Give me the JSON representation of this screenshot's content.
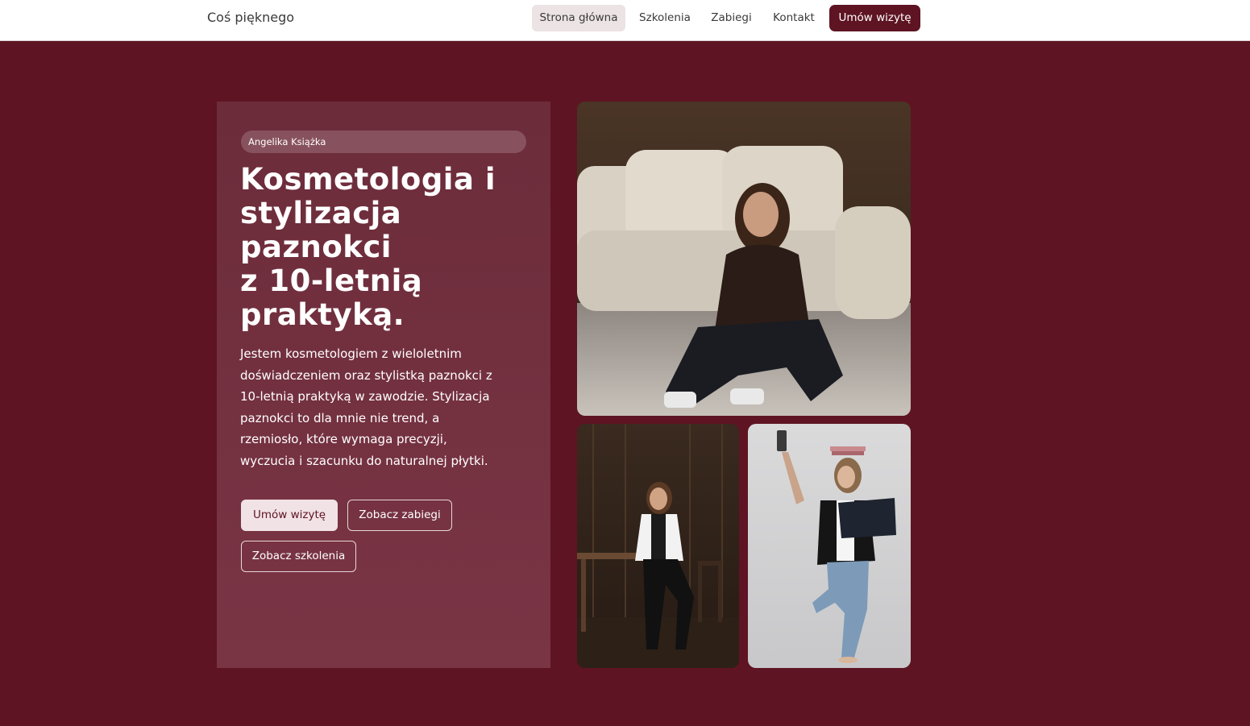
{
  "header": {
    "brand": "Coś pięknego",
    "nav": [
      {
        "label": "Strona główna",
        "active": true
      },
      {
        "label": "Szkolenia",
        "active": false
      },
      {
        "label": "Zabiegi",
        "active": false
      },
      {
        "label": "Kontakt",
        "active": false
      }
    ],
    "cta_label": "Umów wizytę"
  },
  "hero": {
    "badge": "Angelika Książka",
    "headline_lines": [
      "Kosmetologia i",
      "stylizacja",
      "paznokci",
      "z 10-letnią",
      "praktyką."
    ],
    "description_lines": [
      "Jestem kosmetologiem z wieloletnim",
      "doświadczeniem oraz stylistką paznokci z",
      "10-letnią praktyką w zawodzie. Stylizacja",
      "paznokci to dla mnie nie trend, a",
      "rzemiosło, które wymaga precyzji,",
      "wyczucia i szacunku do naturalnej płytki."
    ],
    "buttons": {
      "primary": "Umów wizytę",
      "treatments": "Zobacz zabiegi",
      "trainings": "Zobacz szkolenia"
    }
  },
  "photos": [
    {
      "icon": "photo-woman-sitting-by-sofa"
    },
    {
      "icon": "photo-woman-on-chair"
    },
    {
      "icon": "photo-woman-with-laptop-selfie"
    }
  ],
  "colors": {
    "accent": "#5e1422",
    "card": "#6c2c3a",
    "header_bg": "#ffffff",
    "active_tab": "#ece3e5"
  }
}
